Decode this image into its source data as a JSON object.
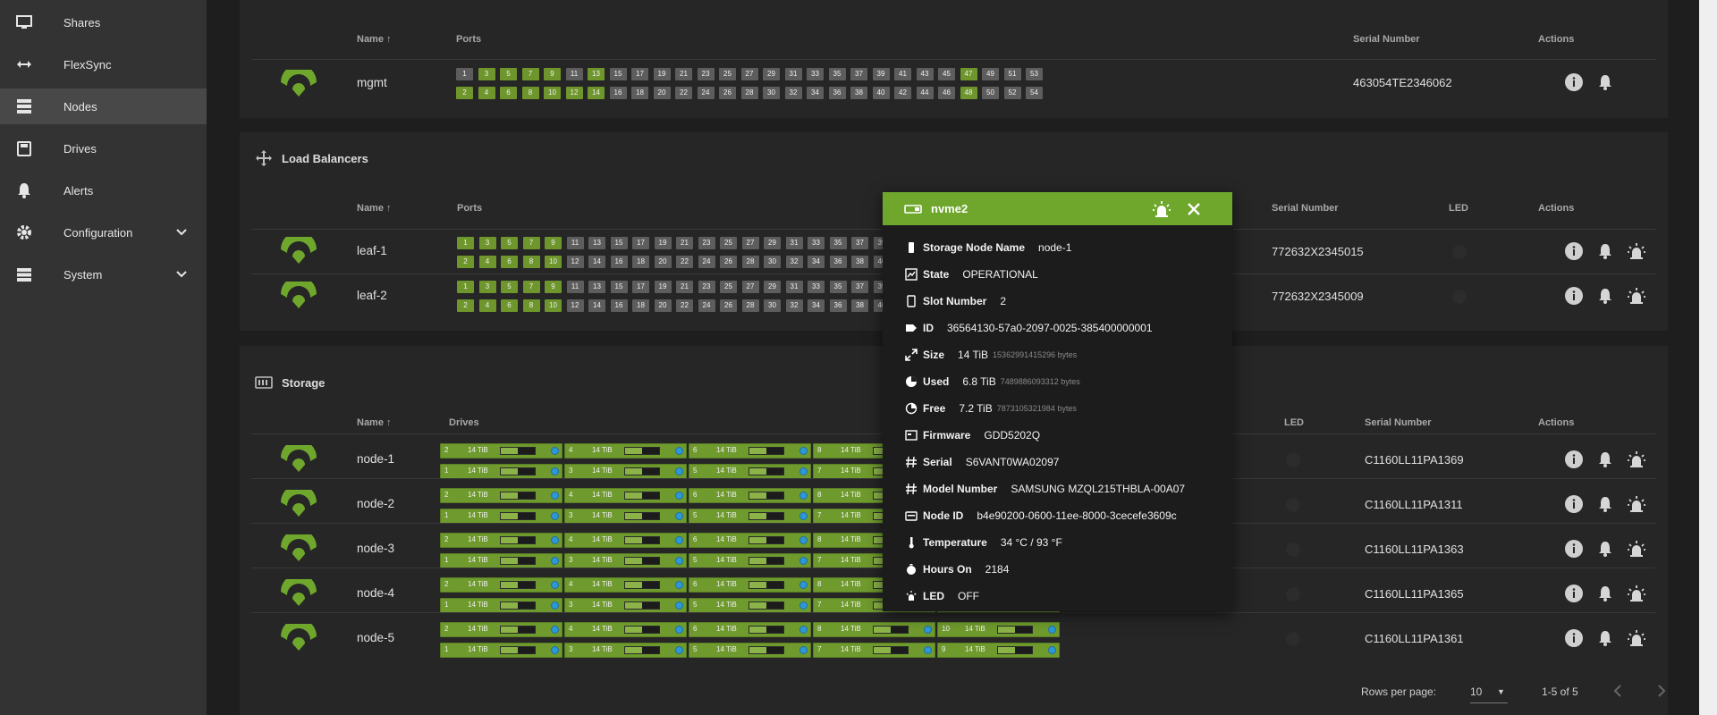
{
  "sidebar": {
    "items": [
      {
        "label": "Shares",
        "icon": "shares-icon"
      },
      {
        "label": "FlexSync",
        "icon": "flexsync-icon"
      },
      {
        "label": "Nodes",
        "icon": "nodes-icon",
        "active": true
      },
      {
        "label": "Drives",
        "icon": "drives-icon"
      },
      {
        "label": "Alerts",
        "icon": "bell-icon"
      },
      {
        "label": "Configuration",
        "icon": "gear-icon",
        "expandable": true
      },
      {
        "label": "System",
        "icon": "system-icon",
        "expandable": true
      }
    ]
  },
  "switches": {
    "headers": {
      "name": "Name",
      "ports": "Ports",
      "serial": "Serial Number",
      "actions": "Actions"
    },
    "rows": [
      {
        "name": "mgmt",
        "serial": "463054TE2346062"
      }
    ]
  },
  "load_balancers": {
    "title": "Load Balancers",
    "headers": {
      "name": "Name",
      "ports": "Ports",
      "serial": "Serial Number",
      "led": "LED",
      "actions": "Actions"
    },
    "rows": [
      {
        "name": "leaf-1",
        "serial": "772632X2345015"
      },
      {
        "name": "leaf-2",
        "serial": "772632X2345009"
      }
    ]
  },
  "storage": {
    "title": "Storage",
    "headers": {
      "name": "Name",
      "drives": "Drives",
      "led": "LED",
      "serial": "Serial Number",
      "actions": "Actions"
    },
    "rows": [
      {
        "name": "node-1",
        "serial": "C1160LL11PA1369"
      },
      {
        "name": "node-2",
        "serial": "C1160LL11PA1311"
      },
      {
        "name": "node-3",
        "serial": "C1160LL11PA1363"
      },
      {
        "name": "node-4",
        "serial": "C1160LL11PA1365"
      },
      {
        "name": "node-5",
        "serial": "C1160LL11PA1361"
      }
    ],
    "drive_size": "14 TiB",
    "drive_top_row": [
      "2",
      "4",
      "6",
      "8",
      "10"
    ],
    "drive_bottom_row": [
      "1",
      "3",
      "5",
      "7",
      "9"
    ],
    "drive_used_fraction": 0.5
  },
  "pagination": {
    "rows_per_page_label": "Rows per page:",
    "rows_per_page": "10",
    "range": "1-5 of 5"
  },
  "ports_top": [
    "1",
    "3",
    "5",
    "7",
    "9",
    "11",
    "13",
    "15",
    "17",
    "19",
    "21",
    "23",
    "25",
    "27",
    "29",
    "31",
    "33",
    "35",
    "37",
    "39",
    "41",
    "43",
    "45",
    "47",
    "49",
    "51",
    "53"
  ],
  "ports_bottom": [
    "2",
    "4",
    "6",
    "8",
    "10",
    "12",
    "14",
    "16",
    "18",
    "20",
    "22",
    "24",
    "26",
    "28",
    "30",
    "32",
    "34",
    "36",
    "38",
    "40",
    "42",
    "44",
    "46",
    "48",
    "50",
    "52",
    "54"
  ],
  "mgmt_ports_up": [
    "3",
    "5",
    "7",
    "9",
    "13",
    "47",
    "2",
    "4",
    "6",
    "8",
    "10",
    "12",
    "14",
    "48"
  ],
  "leaf_ports_up": [
    "1",
    "3",
    "5",
    "7",
    "9",
    "2",
    "4",
    "6",
    "8",
    "10"
  ],
  "popup": {
    "title": "nvme2",
    "fields": [
      {
        "key": "Storage Node Name",
        "value": "node-1",
        "icon": "phone-icon"
      },
      {
        "key": "State",
        "value": "OPERATIONAL",
        "icon": "state-icon"
      },
      {
        "key": "Slot Number",
        "value": "2",
        "icon": "slot-icon"
      },
      {
        "key": "ID",
        "value": "36564130-57a0-2097-0025-385400000001",
        "icon": "tag-icon"
      },
      {
        "key": "Size",
        "value": "14 TiB",
        "bytes": "15362991415296",
        "unit": "bytes",
        "icon": "expand-icon"
      },
      {
        "key": "Used",
        "value": "6.8 TiB",
        "bytes": "7489886093312",
        "unit": "bytes",
        "icon": "pie-icon"
      },
      {
        "key": "Free",
        "value": "7.2 TiB",
        "bytes": "7873105321984",
        "unit": "bytes",
        "icon": "pie-outline-icon"
      },
      {
        "key": "Firmware",
        "value": "GDD5202Q",
        "icon": "firmware-icon"
      },
      {
        "key": "Serial",
        "value": "S6VANT0WA02097",
        "icon": "hash-icon"
      },
      {
        "key": "Model Number",
        "value": "SAMSUNG MZQL215THBLA-00A07",
        "icon": "hash-icon"
      },
      {
        "key": "Node ID",
        "value": "b4e90200-0600-11ee-8000-3cecefe3609c",
        "icon": "id-card-icon"
      },
      {
        "key": "Temperature",
        "value": "34 °C / 93 °F",
        "icon": "thermometer-icon"
      },
      {
        "key": "Hours On",
        "value": "2184",
        "icon": "timer-icon"
      },
      {
        "key": "LED",
        "value": "OFF",
        "icon": "led-icon"
      }
    ]
  }
}
